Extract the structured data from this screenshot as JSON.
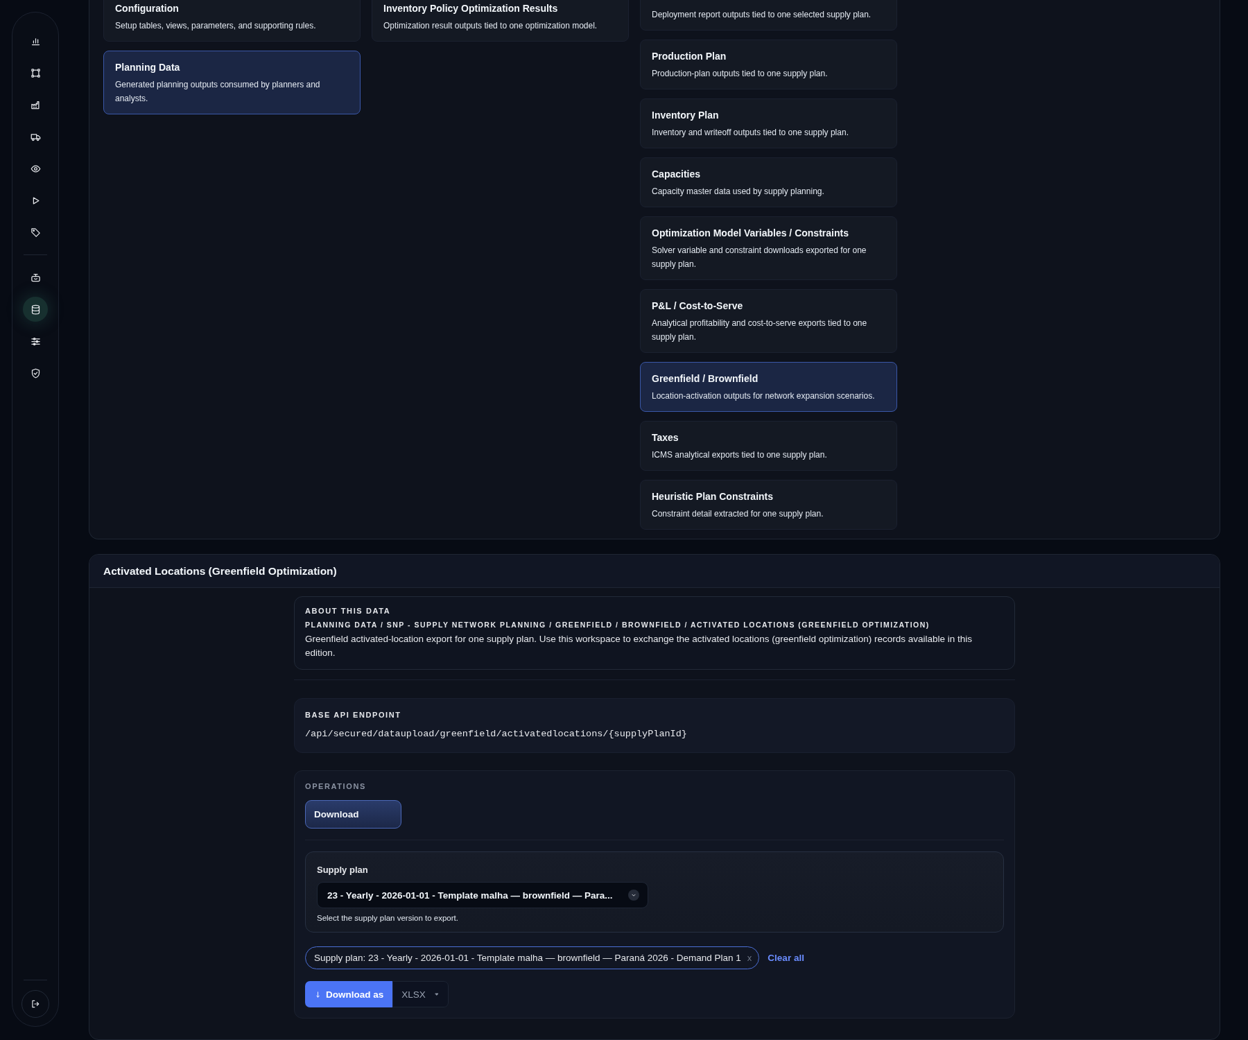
{
  "sidebar": {
    "groups": [
      {
        "items": [
          {
            "selected": false
          },
          {
            "selected": false
          },
          {
            "selected": false
          },
          {
            "selected": false
          },
          {
            "selected": false
          },
          {
            "selected": false
          },
          {
            "selected": false
          }
        ]
      },
      {
        "items": [
          {
            "selected": false
          },
          {
            "selected": true
          },
          {
            "selected": false
          },
          {
            "selected": false
          }
        ]
      }
    ]
  },
  "catalog": {
    "columns": [
      {
        "cards": [
          {
            "title": "Configuration",
            "description": "Setup tables, views, parameters, and supporting rules.",
            "selected": false
          },
          {
            "title": "Planning Data",
            "description": "Generated planning outputs consumed by planners and analysts.",
            "selected": true
          }
        ]
      },
      {
        "cards": [
          {
            "title": "Inventory Policy Optimization Results",
            "description": "Optimization result outputs tied to one optimization model.",
            "selected": false
          }
        ]
      },
      {
        "cards": [
          {
            "description": "Deployment report outputs tied to one selected supply plan.",
            "selected": false
          },
          {
            "title": "Production Plan",
            "description": "Production-plan outputs tied to one supply plan.",
            "selected": false
          },
          {
            "title": "Inventory Plan",
            "description": "Inventory and writeoff outputs tied to one supply plan.",
            "selected": false
          },
          {
            "title": "Capacities",
            "description": "Capacity master data used by supply planning.",
            "selected": false
          },
          {
            "title": "Optimization Model Variables / Constraints",
            "description": "Solver variable and constraint downloads exported for one supply plan.",
            "selected": false
          },
          {
            "title": "P&L / Cost-to-Serve",
            "description": "Analytical profitability and cost-to-serve exports tied to one supply plan.",
            "selected": false
          },
          {
            "title": "Greenfield / Brownfield",
            "description": "Location-activation outputs for network expansion scenarios.",
            "selected": true
          },
          {
            "title": "Taxes",
            "description": "ICMS analytical exports tied to one supply plan.",
            "selected": false
          },
          {
            "title": "Heuristic Plan Constraints",
            "description": "Constraint detail extracted for one supply plan.",
            "selected": false
          }
        ]
      }
    ]
  },
  "detail": {
    "title": "Activated Locations (Greenfield Optimization)",
    "about": {
      "heading": "ABOUT THIS DATA",
      "breadcrumb": "PLANNING DATA / SNP - SUPPLY NETWORK PLANNING / GREENFIELD / BROWNFIELD / ACTIVATED LOCATIONS (GREENFIELD OPTIMIZATION)",
      "description": "Greenfield activated-location export for one supply plan. Use this workspace to exchange the activated locations (greenfield optimization) records available in this edition."
    },
    "endpoint": {
      "heading": "BASE API ENDPOINT",
      "path": "/api/secured/dataupload/greenfield/activatedlocations/{supplyPlanId}"
    },
    "operations": {
      "heading": "OPERATIONS",
      "items": [
        {
          "label": "Download",
          "selected": true
        }
      ],
      "supply_plan": {
        "label": "Supply plan",
        "value": "23 - Yearly - 2026-01-01 - Template malha — brownfield — Para...",
        "hint": "Select the supply plan version to export."
      },
      "filter_chip": {
        "text": "Supply plan: 23 - Yearly - 2026-01-01 - Template malha — brownfield — Paraná 2026 - Demand Plan 1",
        "remove": "x"
      },
      "clear_all": "Clear all",
      "download_button": "Download as",
      "format": "XLSX"
    }
  }
}
